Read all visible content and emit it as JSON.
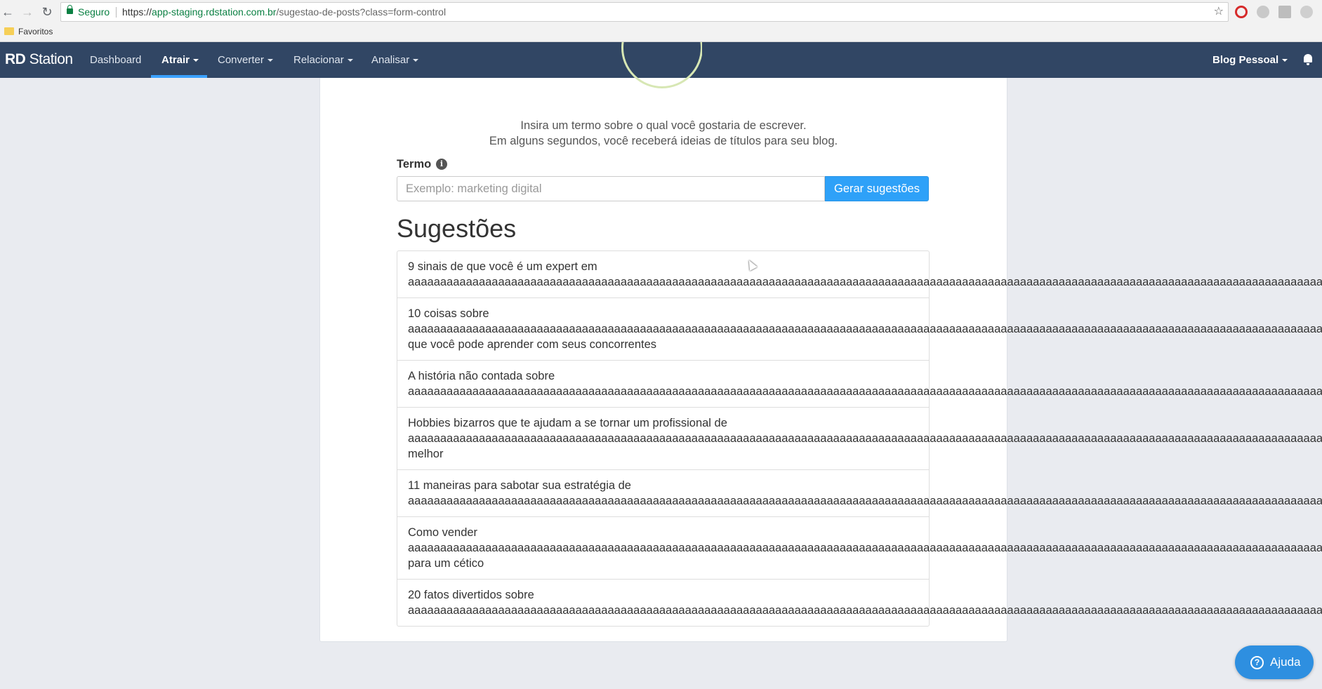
{
  "browser": {
    "secure_label": "Seguro",
    "url_scheme": "https://",
    "url_host": "app-staging.rdstation.com.br",
    "url_path": "/sugestao-de-posts?class=form-control",
    "bookmark_folder": "Favoritos"
  },
  "navbar": {
    "logo_bold": "RD",
    "logo_rest": " Station",
    "items": [
      {
        "label": "Dashboard"
      },
      {
        "label": "Atrair",
        "active": true
      },
      {
        "label": "Converter"
      },
      {
        "label": "Relacionar"
      },
      {
        "label": "Analisar"
      }
    ],
    "account": "Blog Pessoal"
  },
  "main": {
    "intro_line1": "Insira um termo sobre o qual você gostaria de escrever.",
    "intro_line2": "Em alguns segundos, você receberá ideias de títulos para seu blog.",
    "term_label": "Termo",
    "term_placeholder": "Exemplo: marketing digital",
    "term_value": "",
    "generate_button": "Gerar sugestões",
    "suggestions_title": "Sugestões",
    "suggestions": [
      {
        "lines": [
          "9 sinais de que você é um expert em",
          "aaaaaaaaaaaaaaaaaaaaaaaaaaaaaaaaaaaaaaaaaaaaaaaaaaaaaaaaaaaaaaaaaaaaaaaaaaaaaaaaaaaaaaaaaaaaaaaaaaaaaaaaaaaaaaaaaaaaaaaaaaaaaaaaaaaaaaaaaaaaaaaaaaaa"
        ]
      },
      {
        "lines": [
          "10 coisas sobre",
          "aaaaaaaaaaaaaaaaaaaaaaaaaaaaaaaaaaaaaaaaaaaaaaaaaaaaaaaaaaaaaaaaaaaaaaaaaaaaaaaaaaaaaaaaaaaaaaaaaaaaaaaaaaaaaaaaaaaaaaaaaaaaaaaaaaaaaaaaaaaaaaaaaaaa",
          "que você pode aprender com seus concorrentes"
        ]
      },
      {
        "lines": [
          "A história não contada sobre",
          "aaaaaaaaaaaaaaaaaaaaaaaaaaaaaaaaaaaaaaaaaaaaaaaaaaaaaaaaaaaaaaaaaaaaaaaaaaaaaaaaaaaaaaaaaaaaaaaaaaaaaaaaaaaaaaaaaaaaaaaaaaaaaaaaaaaaaaaaaaaaaaaaaaaa"
        ]
      },
      {
        "lines": [
          "Hobbies bizarros que te ajudam a se tornar um profissional de",
          "aaaaaaaaaaaaaaaaaaaaaaaaaaaaaaaaaaaaaaaaaaaaaaaaaaaaaaaaaaaaaaaaaaaaaaaaaaaaaaaaaaaaaaaaaaaaaaaaaaaaaaaaaaaaaaaaaaaaaaaaaaaaaaaaaaaaaaaaaaaaaaaaaaaa",
          "melhor"
        ]
      },
      {
        "lines": [
          "11 maneiras para sabotar sua estratégia de",
          "aaaaaaaaaaaaaaaaaaaaaaaaaaaaaaaaaaaaaaaaaaaaaaaaaaaaaaaaaaaaaaaaaaaaaaaaaaaaaaaaaaaaaaaaaaaaaaaaaaaaaaaaaaaaaaaaaaaaaaaaaaaaaaaaaaaaaaaaaaaaaaaaaaaa"
        ]
      },
      {
        "lines": [
          "Como vender",
          "aaaaaaaaaaaaaaaaaaaaaaaaaaaaaaaaaaaaaaaaaaaaaaaaaaaaaaaaaaaaaaaaaaaaaaaaaaaaaaaaaaaaaaaaaaaaaaaaaaaaaaaaaaaaaaaaaaaaaaaaaaaaaaaaaaaaaaaaaaaaaaaaaaaa",
          "para um cético"
        ]
      },
      {
        "lines": [
          "20 fatos divertidos sobre",
          "aaaaaaaaaaaaaaaaaaaaaaaaaaaaaaaaaaaaaaaaaaaaaaaaaaaaaaaaaaaaaaaaaaaaaaaaaaaaaaaaaaaaaaaaaaaaaaaaaaaaaaaaaaaaaaaaaaaaaaaaaaaaaaaaaaaaaaaaaaaaaaaaaaaa"
        ]
      }
    ]
  },
  "help_button": "Ajuda",
  "colors": {
    "navbar_bg": "#314664",
    "accent": "#2ea1f8",
    "page_bg": "#e9ebf0"
  }
}
